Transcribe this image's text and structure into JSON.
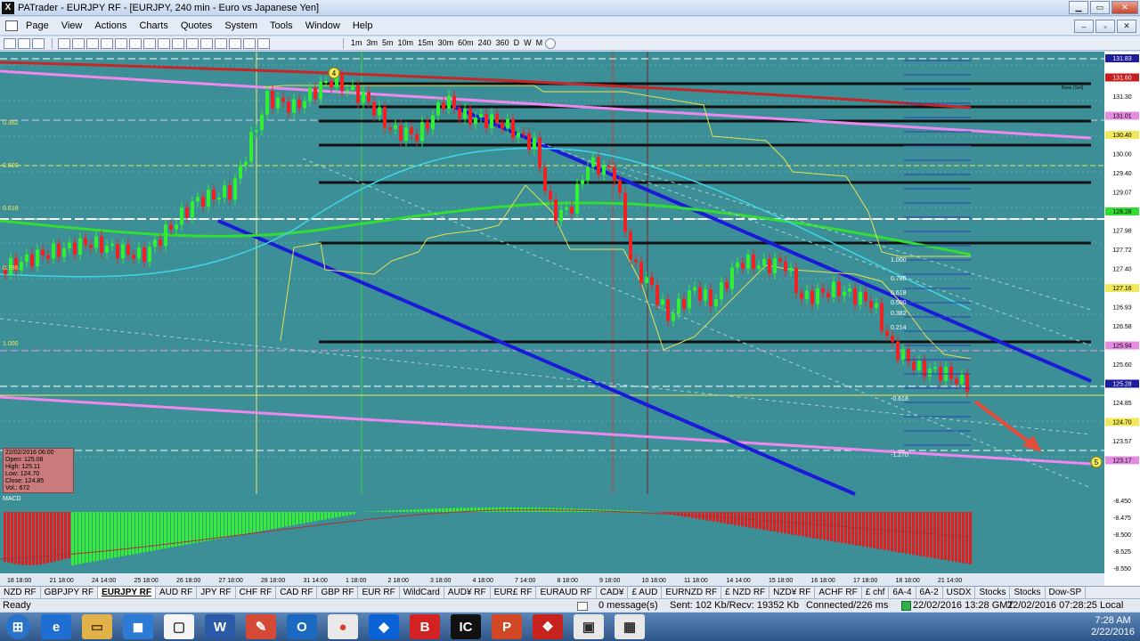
{
  "window": {
    "title": "PATrader - EURJPY RF - [EURJPY, 240 min - Euro vs Japanese Yen]",
    "app_icon": "X",
    "child_controls": [
      "–",
      "▫",
      "✕"
    ]
  },
  "menu": [
    "Page",
    "View",
    "Actions",
    "Charts",
    "Quotes",
    "System",
    "Tools",
    "Window",
    "Help"
  ],
  "toolbar": {
    "timeframes": [
      "1m",
      "3m",
      "5m",
      "10m",
      "15m",
      "30m",
      "60m",
      "240",
      "360",
      "D",
      "W",
      "M"
    ]
  },
  "chart": {
    "symbol_label": "EURJPY",
    "price_labels": [
      {
        "text": "131.83",
        "hl": "#1c1c9e"
      },
      {
        "text": "131.60",
        "hl": "#c51d1d"
      },
      {
        "text": "131.30",
        "hl": ""
      },
      {
        "text": "131.01",
        "hl": "#e48ce0"
      },
      {
        "text": "130.40",
        "hl": "#f1e85a"
      },
      {
        "text": "130.00",
        "hl": ""
      },
      {
        "text": "129.40",
        "hl": ""
      },
      {
        "text": "129.07",
        "hl": "#ffffff"
      },
      {
        "text": "128.28",
        "hl": "#33dd33"
      },
      {
        "text": "127.98",
        "hl": ""
      },
      {
        "text": "127.72",
        "hl": ""
      },
      {
        "text": "127.40",
        "hl": ""
      },
      {
        "text": "127.16",
        "hl": "#f1e85a"
      },
      {
        "text": "126.93",
        "hl": ""
      },
      {
        "text": "126.58",
        "hl": ""
      },
      {
        "text": "125.94",
        "hl": "#e48ce0"
      },
      {
        "text": "125.60",
        "hl": ""
      },
      {
        "text": "125.28",
        "hl": "#1c1c9e"
      },
      {
        "text": "124.85",
        "hl": "#ffffff"
      },
      {
        "text": "124.70",
        "hl": "#f1e85a"
      },
      {
        "text": "123.57",
        "hl": ""
      },
      {
        "text": "123.17",
        "hl": "#e48ce0"
      }
    ],
    "fib_left": [
      "0.382",
      "0.500",
      "0.618",
      "0.786",
      "1.000"
    ],
    "fib_right": [
      "1.000",
      "0.786",
      "0.618",
      "0.500",
      "0.382",
      "0.214",
      "-0.618",
      "-1.270"
    ],
    "level_tags": [
      "Base (Sell)"
    ],
    "markers": [
      "4",
      "5"
    ],
    "info_box": {
      "date": "22/02/2016 06:00",
      "open": "Open: 125.08",
      "high": "High: 125.11",
      "low": "Low: 124.70",
      "close": "Close: 124.85",
      "vol": "Vol.: 672"
    },
    "macd": {
      "label": "MACD",
      "scale": [
        "-8.450",
        "-8.475",
        "-8.500",
        "-8.525",
        "-8.550"
      ]
    },
    "date_labels": [
      "18 18:00",
      "21 18:00",
      "24 14:00",
      "25 18:00",
      "26 18:00",
      "27 18:00",
      "28 18:00",
      "31 14:00",
      "1 18:00",
      "2 18:00",
      "3 18:00",
      "4 18:00",
      "7 14:00",
      "8 18:00",
      "9 18:00",
      "10 18:00",
      "11 18:00",
      "14 14:00",
      "15 18:00",
      "16 18:00",
      "17 18:00",
      "18 18:00",
      "21 14:00"
    ]
  },
  "chart_data": {
    "type": "candlestick",
    "title": "EURJPY, 240 min - Euro vs Japanese Yen",
    "ylim": [
      122.5,
      132.0
    ],
    "last_bar": {
      "date": "22/02/2016 06:00",
      "open": 125.08,
      "high": 125.11,
      "low": 124.7,
      "close": 124.85,
      "volume": 672
    },
    "moving_average_ribbon_color": "#33dd33",
    "colors": {
      "bull": "#33ee33",
      "bear": "#ee2222",
      "channel": "#1a1ad8",
      "trendline_pink": "#ee88ee"
    }
  },
  "symbol_tabs": [
    "NZD RF",
    "GBPJPY RF",
    "EURJPY RF",
    "AUD RF",
    "JPY RF",
    "CHF RF",
    "CAD RF",
    "GBP RF",
    "EUR RF",
    "WildCard",
    "AUD¥ RF",
    "EUR£ RF",
    "EURAUD RF",
    "CAD¥",
    "£ AUD",
    "EURNZD RF",
    "£ NZD RF",
    "NZD¥ RF",
    "ACHF RF",
    "£ chf",
    "6A-4",
    "6A-2",
    "USDX",
    "Stocks",
    "Stocks",
    "Dow-SP"
  ],
  "active_tab": "EURJPY RF",
  "status": {
    "ready": "Ready",
    "messages": "0 message(s)",
    "traffic": "Sent: 102 Kb/Recv: 19352 Kb",
    "connection": "Connected/226 ms",
    "gmt_time": "22/02/2016 13:28 GMT",
    "local_time": "22/02/2016 07:28:25 Local"
  },
  "taskbar": {
    "apps": [
      {
        "glyph": "⊞",
        "bg": "#2a73c9",
        "fg": "#ffffff"
      },
      {
        "glyph": "e",
        "bg": "#1e6fd1",
        "fg": "#ffffff"
      },
      {
        "glyph": "▭",
        "bg": "#e1b24a",
        "fg": "#5b3c00"
      },
      {
        "glyph": "◼",
        "bg": "#2e7bd6",
        "fg": "#ffffff"
      },
      {
        "glyph": "▢",
        "bg": "#f4f4f4",
        "fg": "#333333"
      },
      {
        "glyph": "W",
        "bg": "#2a5aa8",
        "fg": "#ffffff"
      },
      {
        "glyph": "✎",
        "bg": "#d44a36",
        "fg": "#ffffff"
      },
      {
        "glyph": "O",
        "bg": "#1b6ac0",
        "fg": "#ffffff"
      },
      {
        "glyph": "●",
        "bg": "#e9e9e9",
        "fg": "#dd3b2c"
      },
      {
        "glyph": "◆",
        "bg": "#0a62d6",
        "fg": "#ffffff"
      },
      {
        "glyph": "B",
        "bg": "#d42222",
        "fg": "#ffffff"
      },
      {
        "glyph": "IC",
        "bg": "#111111",
        "fg": "#ffffff"
      },
      {
        "glyph": "P",
        "bg": "#d24725",
        "fg": "#ffffff"
      },
      {
        "glyph": "❖",
        "bg": "#c8221e",
        "fg": "#ffffff"
      },
      {
        "glyph": "▣",
        "bg": "#e8e8e8",
        "fg": "#2d2d2d"
      },
      {
        "glyph": "▦",
        "bg": "#e8e8e8",
        "fg": "#2d2d2d"
      }
    ],
    "time": "7:28 AM",
    "date": "2/22/2016"
  }
}
